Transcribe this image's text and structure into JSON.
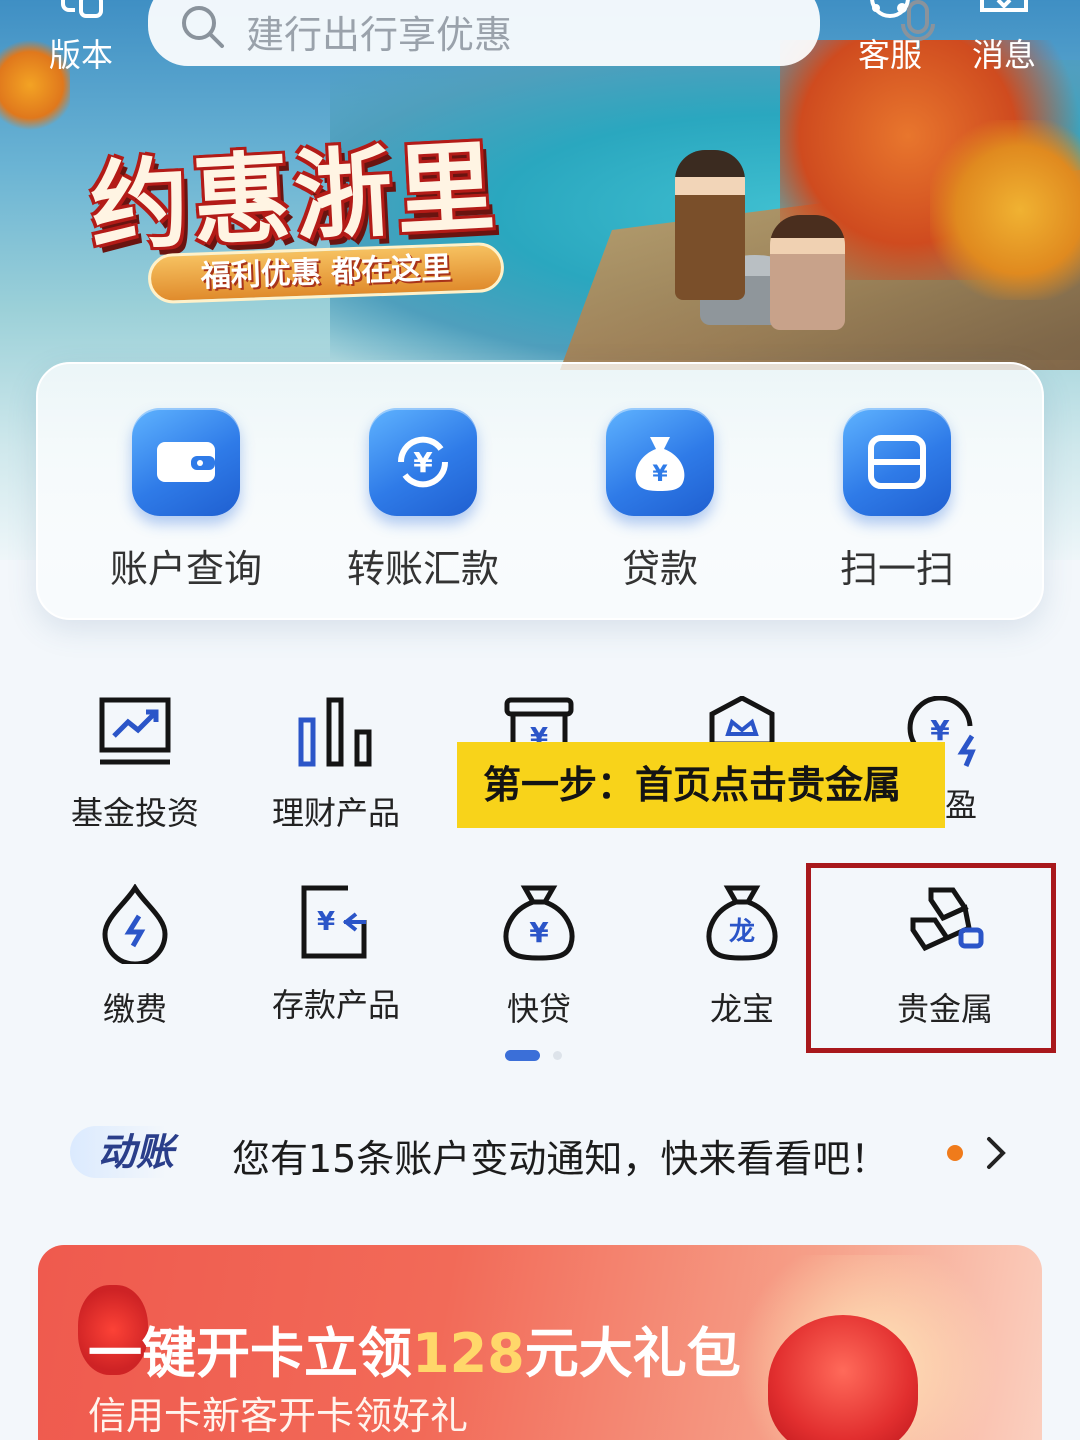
{
  "topbar": {
    "left_label": "版本",
    "search_placeholder": "建行出行享优惠",
    "service_label": "客服",
    "message_label": "消息"
  },
  "hero": {
    "title": "约惠浙里",
    "subtitle": "福利优惠 都在这里"
  },
  "quick_actions": [
    {
      "label": "账户查询",
      "icon": "wallet-icon"
    },
    {
      "label": "转账汇款",
      "icon": "yuan-transfer-icon"
    },
    {
      "label": "贷款",
      "icon": "money-bag-icon"
    },
    {
      "label": "扫一扫",
      "icon": "scan-icon"
    }
  ],
  "grid": {
    "row1": [
      {
        "label": "基金投资",
        "icon": "chart-monitor-icon"
      },
      {
        "label": "理财产品",
        "icon": "bar-chart-icon"
      },
      {
        "label": "",
        "icon": "yuan-box-icon"
      },
      {
        "label": "",
        "icon": "crown-shield-icon"
      },
      {
        "label": "盈",
        "icon": "yuan-bolt-icon"
      }
    ],
    "row2": [
      {
        "label": "缴费",
        "icon": "drop-bolt-icon"
      },
      {
        "label": "存款产品",
        "icon": "deposit-card-icon"
      },
      {
        "label": "快贷",
        "icon": "yuan-bag-icon"
      },
      {
        "label": "龙宝",
        "icon": "dragon-bag-icon"
      },
      {
        "label": "贵金属",
        "icon": "gold-bar-icon"
      }
    ]
  },
  "instruction": "第一步：首页点击贵金属",
  "notice": {
    "badge": "动账",
    "text": "您有15条账户变动通知，快来看看吧！"
  },
  "promo": {
    "title_prefix": "一键开卡立领",
    "title_highlight": "128",
    "title_suffix": "元大礼包",
    "subtitle": "信用卡新客开卡领好礼"
  },
  "colors": {
    "accent_blue": "#2f7be8",
    "highlight_yellow": "#f8d31a",
    "highlight_border": "#a8181c",
    "notice_dot": "#f07b1b",
    "promo_red": "#ef5a4e"
  }
}
